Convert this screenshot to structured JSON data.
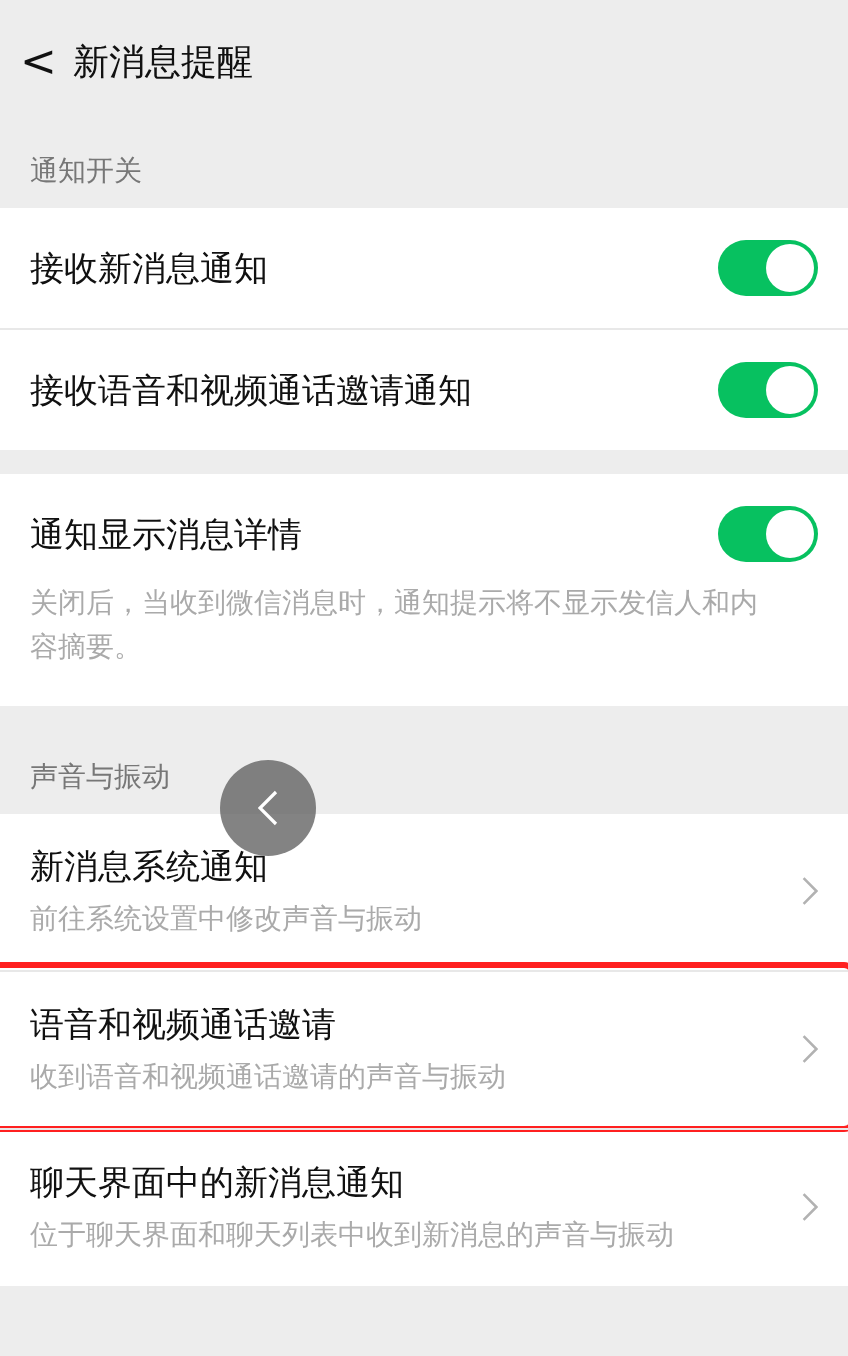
{
  "header": {
    "back": "<",
    "title": "新消息提醒"
  },
  "sections": [
    {
      "label": "通知开关",
      "cards": [
        [
          {
            "kind": "switch",
            "title": "接收新消息通知",
            "on": true
          },
          {
            "kind": "switch",
            "title": "接收语音和视频通话邀请通知",
            "on": true
          }
        ],
        [
          {
            "kind": "switch",
            "title": "通知显示消息详情",
            "on": true,
            "description": "关闭后，当收到微信消息时，通知提示将不显示发信人和内容摘要。"
          }
        ]
      ]
    },
    {
      "label": "声音与振动",
      "cards": [
        [
          {
            "kind": "link",
            "title": "新消息系统通知",
            "description": "前往系统设置中修改声音与振动",
            "highlighted": false
          },
          {
            "kind": "link",
            "title": "语音和视频通话邀请",
            "description": "收到语音和视频通话邀请的声音与振动",
            "highlighted": true
          },
          {
            "kind": "link",
            "title": "聊天界面中的新消息通知",
            "description": "位于聊天界面和聊天列表中收到新消息的声音与振动",
            "highlighted": false
          }
        ]
      ]
    }
  ],
  "floating_button": {
    "kind": "back"
  }
}
